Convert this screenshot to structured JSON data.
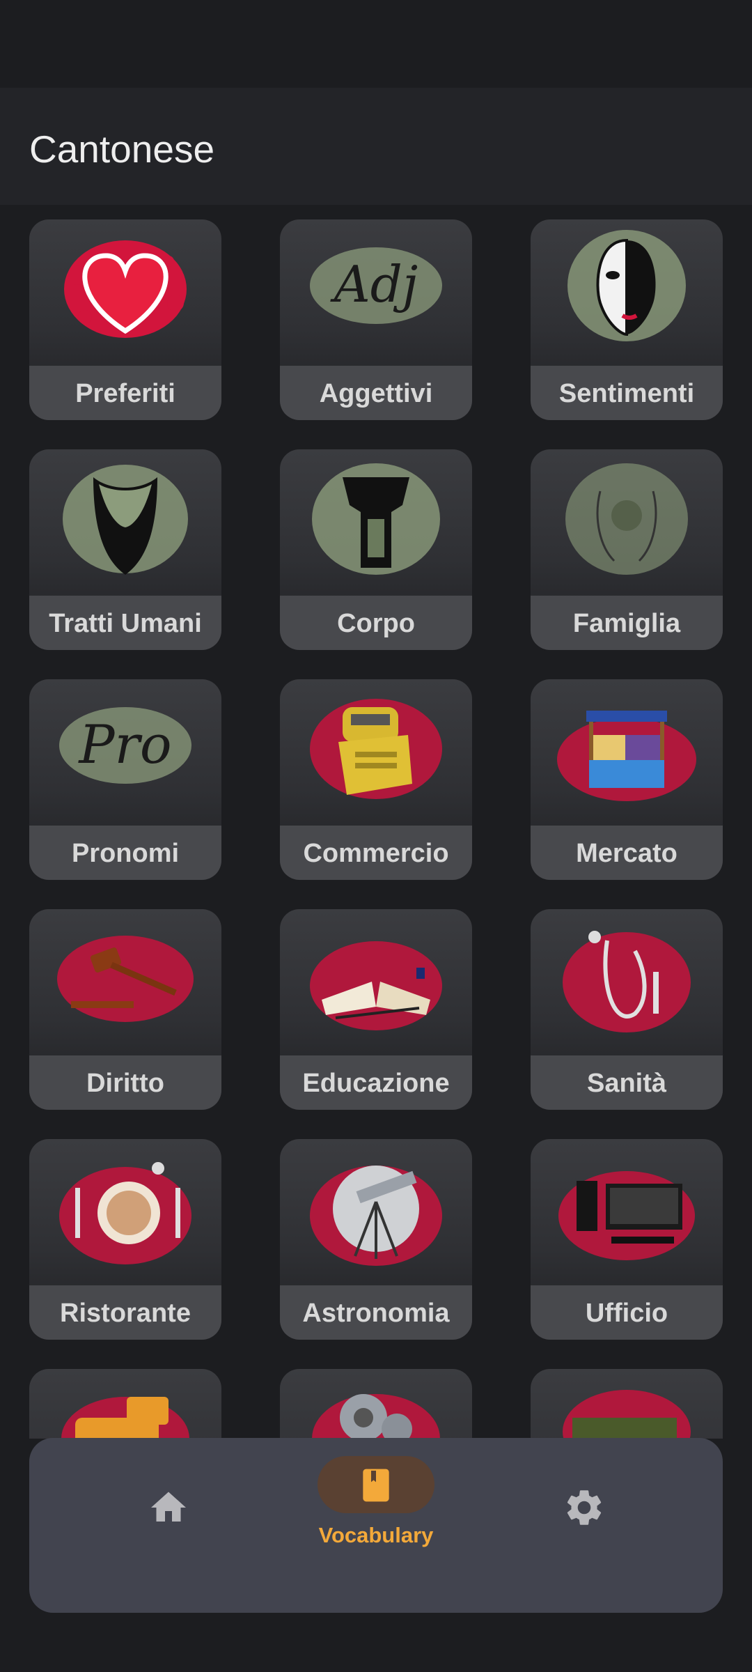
{
  "app": {
    "title": "Cantonese"
  },
  "categories": [
    {
      "label": "Preferiti",
      "icon": "heart-icon"
    },
    {
      "label": "Aggettivi",
      "icon": "adj-text-icon"
    },
    {
      "label": "Sentimenti",
      "icon": "mask-icon"
    },
    {
      "label": "Tratti Umani",
      "icon": "face-mask-icon"
    },
    {
      "label": "Corpo",
      "icon": "body-icon"
    },
    {
      "label": "Famiglia",
      "icon": "family-icon"
    },
    {
      "label": "Pronomi",
      "icon": "pro-text-icon"
    },
    {
      "label": "Commercio",
      "icon": "cash-register-icon"
    },
    {
      "label": "Mercato",
      "icon": "market-stall-icon"
    },
    {
      "label": "Diritto",
      "icon": "gavel-icon"
    },
    {
      "label": "Educazione",
      "icon": "book-icon"
    },
    {
      "label": "Sanità",
      "icon": "stethoscope-icon"
    },
    {
      "label": "Ristorante",
      "icon": "plate-icon"
    },
    {
      "label": "Astronomia",
      "icon": "telescope-icon"
    },
    {
      "label": "Ufficio",
      "icon": "computer-icon"
    },
    {
      "label": "",
      "icon": "tractor-icon"
    },
    {
      "label": "",
      "icon": "gears-icon"
    },
    {
      "label": "",
      "icon": "tank-icon"
    }
  ],
  "nav": {
    "items": [
      {
        "name": "home",
        "icon": "home-icon",
        "label": ""
      },
      {
        "name": "vocabulary",
        "icon": "book-icon",
        "label": "Vocabulary",
        "active": true
      },
      {
        "name": "settings",
        "icon": "gear-icon",
        "label": ""
      }
    ],
    "active_color": "#f3a93a"
  },
  "colors": {
    "background": "#1c1d20",
    "card_label": "#48494d",
    "nav_bg": "#42444f",
    "splash_red": "#c0183c",
    "splash_green": "#8c9c7c"
  }
}
